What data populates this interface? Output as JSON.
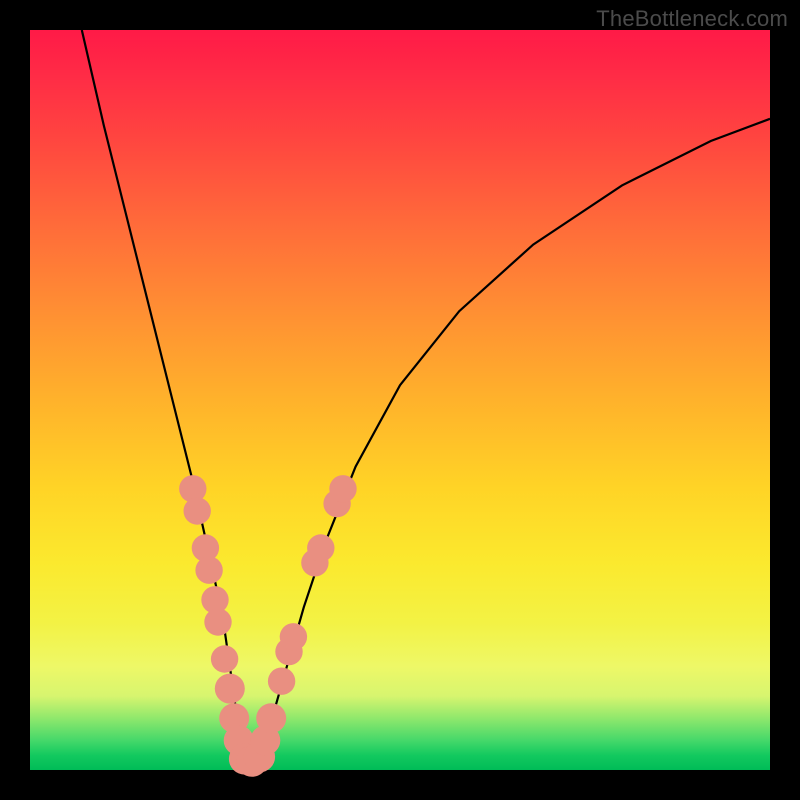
{
  "watermark": "TheBottleneck.com",
  "colors": {
    "frame": "#000000",
    "curve": "#000000",
    "marker_fill": "#e98f81",
    "marker_stroke": "#d77a6c"
  },
  "chart_data": {
    "type": "line",
    "title": "",
    "xlabel": "",
    "ylabel": "",
    "xlim": [
      0,
      100
    ],
    "ylim": [
      0,
      100
    ],
    "grid": false,
    "legend": false,
    "note": "Values are percentages of the plot area; the vertical axis is inverted (0 = bottom, 100 = top). Curve is a V-shape with vertex near x≈29 reaching y≈0.",
    "series": [
      {
        "name": "bottleneck-curve",
        "x": [
          7,
          10,
          13,
          16,
          19,
          22,
          24,
          26,
          27,
          28,
          29,
          30,
          31,
          33,
          35,
          37,
          40,
          44,
          50,
          58,
          68,
          80,
          92,
          100
        ],
        "y": [
          100,
          87,
          75,
          63,
          51,
          39,
          30,
          21,
          14,
          7,
          1,
          1,
          3,
          8,
          15,
          22,
          31,
          41,
          52,
          62,
          71,
          79,
          85,
          88
        ]
      }
    ],
    "markers": [
      {
        "series": "bottleneck-curve",
        "x": 22.0,
        "y": 38,
        "r": 1.3
      },
      {
        "series": "bottleneck-curve",
        "x": 22.6,
        "y": 35,
        "r": 1.3
      },
      {
        "series": "bottleneck-curve",
        "x": 23.7,
        "y": 30,
        "r": 1.3
      },
      {
        "series": "bottleneck-curve",
        "x": 24.2,
        "y": 27,
        "r": 1.3
      },
      {
        "series": "bottleneck-curve",
        "x": 25.0,
        "y": 23,
        "r": 1.3
      },
      {
        "series": "bottleneck-curve",
        "x": 25.4,
        "y": 20,
        "r": 1.3
      },
      {
        "series": "bottleneck-curve",
        "x": 26.3,
        "y": 15,
        "r": 1.3
      },
      {
        "series": "bottleneck-curve",
        "x": 27.0,
        "y": 11,
        "r": 1.5
      },
      {
        "series": "bottleneck-curve",
        "x": 27.6,
        "y": 7,
        "r": 1.5
      },
      {
        "series": "bottleneck-curve",
        "x": 28.2,
        "y": 4,
        "r": 1.5
      },
      {
        "series": "bottleneck-curve",
        "x": 29.0,
        "y": 1.5,
        "r": 1.6
      },
      {
        "series": "bottleneck-curve",
        "x": 30.0,
        "y": 1.2,
        "r": 1.6
      },
      {
        "series": "bottleneck-curve",
        "x": 31.0,
        "y": 1.8,
        "r": 1.6
      },
      {
        "series": "bottleneck-curve",
        "x": 31.8,
        "y": 4,
        "r": 1.5
      },
      {
        "series": "bottleneck-curve",
        "x": 32.6,
        "y": 7,
        "r": 1.5
      },
      {
        "series": "bottleneck-curve",
        "x": 34.0,
        "y": 12,
        "r": 1.3
      },
      {
        "series": "bottleneck-curve",
        "x": 35.0,
        "y": 16,
        "r": 1.3
      },
      {
        "series": "bottleneck-curve",
        "x": 35.6,
        "y": 18,
        "r": 1.3
      },
      {
        "series": "bottleneck-curve",
        "x": 38.5,
        "y": 28,
        "r": 1.3
      },
      {
        "series": "bottleneck-curve",
        "x": 39.3,
        "y": 30,
        "r": 1.3
      },
      {
        "series": "bottleneck-curve",
        "x": 41.5,
        "y": 36,
        "r": 1.3
      },
      {
        "series": "bottleneck-curve",
        "x": 42.3,
        "y": 38,
        "r": 1.3
      }
    ]
  }
}
